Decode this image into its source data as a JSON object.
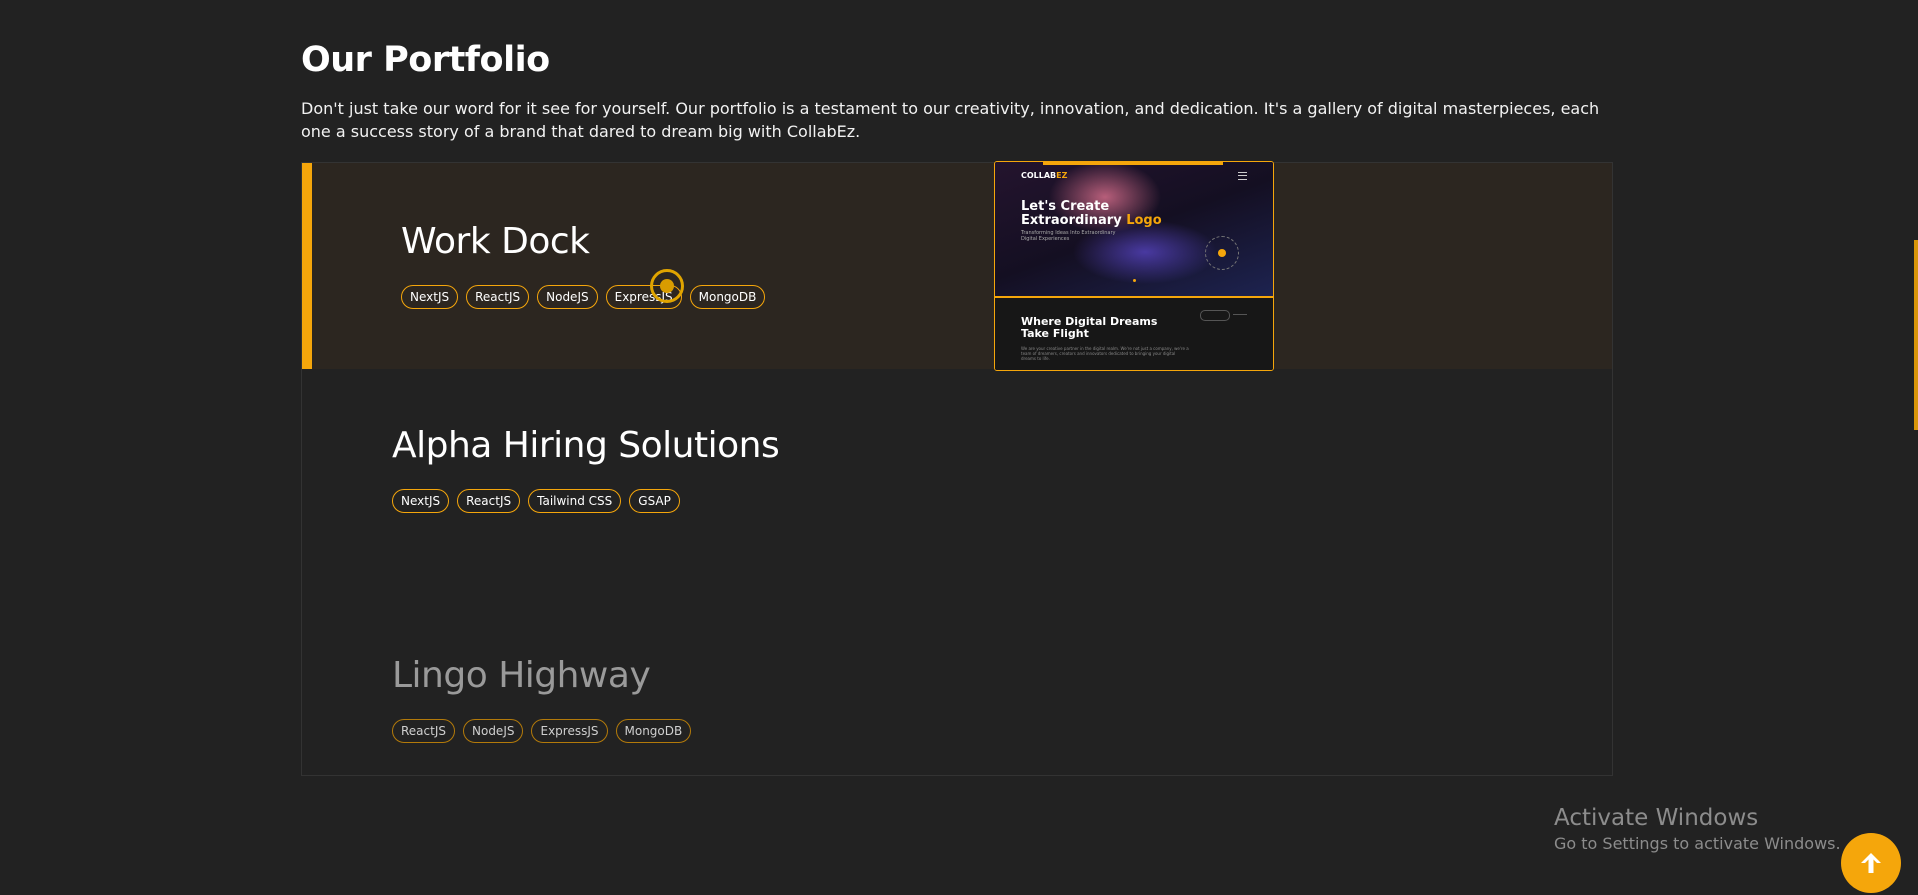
{
  "portfolio": {
    "heading": "Our Portfolio",
    "intro": "Don't just take our word for it see for yourself. Our portfolio is a testament to our creativity, innovation, and dedication. It's a gallery of digital masterpieces, each one a success story of a brand that dared to dream big with CollabEz.",
    "projects": [
      {
        "title": "Work Dock",
        "tags": [
          "NextJS",
          "ReactJS",
          "NodeJS",
          "ExpressJS",
          "MongoDB"
        ]
      },
      {
        "title": "Alpha Hiring Solutions",
        "tags": [
          "NextJS",
          "ReactJS",
          "Tailwind CSS",
          "GSAP"
        ]
      },
      {
        "title": "Lingo Highway",
        "tags": [
          "ReactJS",
          "NodeJS",
          "ExpressJS",
          "MongoDB"
        ]
      }
    ]
  },
  "preview": {
    "logo_main": "COLLAB",
    "logo_accent": "EZ",
    "headline_line1": "Let's Create",
    "headline_line2": "Extraordinary",
    "headline_accent": "Logo",
    "subline": "Transforming Ideas Into Extraordinary Digital Experiences",
    "section_title_line1": "Where Digital Dreams",
    "section_title_line2": "Take Flight",
    "section_text": "We are your creative partner in the digital realm. We're not just a company, we're a team of dreamers, creators and innovators dedicated to bringing your digital dreams to life."
  },
  "watermark": {
    "title": "Activate Windows",
    "subtitle": "Go to Settings to activate Windows."
  },
  "colors": {
    "accent": "#f5a60b",
    "background": "#222222",
    "active_row": "#2c2620"
  },
  "icons": {
    "scroll_top": "arrow-up-icon"
  }
}
